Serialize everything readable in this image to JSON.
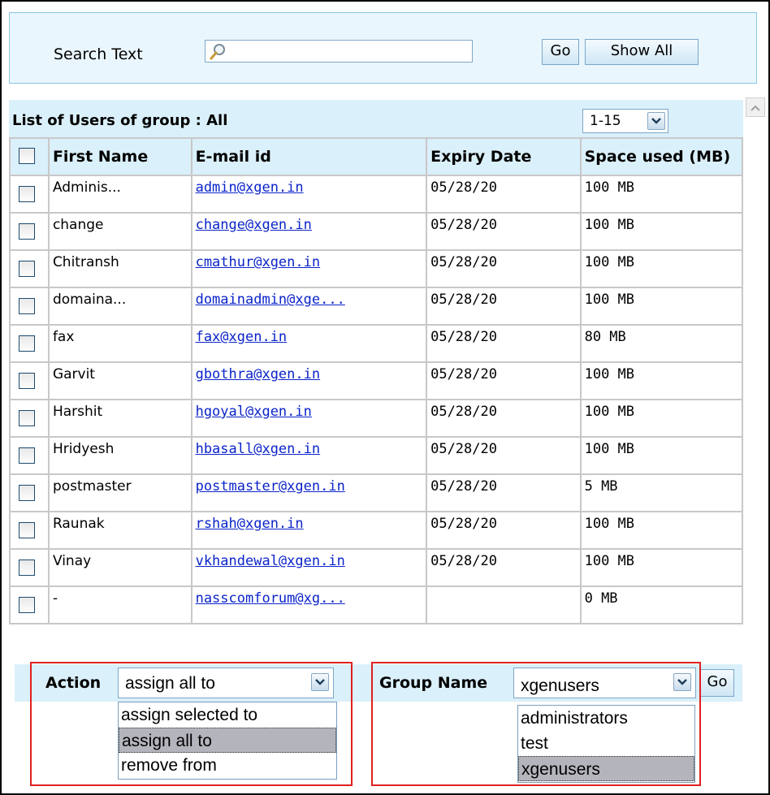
{
  "search": {
    "label": "Search Text",
    "value": "",
    "go_label": "Go",
    "show_all_label": "Show All"
  },
  "list": {
    "title": "List of Users of group : All",
    "range": "1-15",
    "headers": {
      "first_name": "First Name",
      "email": "E-mail id",
      "expiry": "Expiry Date",
      "space": "Space used (MB)"
    },
    "rows": [
      {
        "first_name": "Adminis...",
        "email": "admin@xgen.in",
        "expiry": "05/28/20",
        "space": "100 MB"
      },
      {
        "first_name": "change",
        "email": "change@xgen.in",
        "expiry": "05/28/20",
        "space": "100 MB"
      },
      {
        "first_name": "Chitransh",
        "email": "cmathur@xgen.in",
        "expiry": "05/28/20",
        "space": "100 MB"
      },
      {
        "first_name": "domaina...",
        "email": "domainadmin@xge...",
        "expiry": "05/28/20",
        "space": "100 MB"
      },
      {
        "first_name": "fax",
        "email": "fax@xgen.in",
        "expiry": "05/28/20",
        "space": "80 MB"
      },
      {
        "first_name": "Garvit",
        "email": "gbothra@xgen.in",
        "expiry": "05/28/20",
        "space": "100 MB"
      },
      {
        "first_name": "Harshit",
        "email": "hgoyal@xgen.in",
        "expiry": "05/28/20",
        "space": "100 MB"
      },
      {
        "first_name": "Hridyesh",
        "email": "hbasall@xgen.in",
        "expiry": "05/28/20",
        "space": "100 MB"
      },
      {
        "first_name": "postmaster",
        "email": "postmaster@xgen.in",
        "expiry": "05/28/20",
        "space": "5 MB"
      },
      {
        "first_name": "Raunak",
        "email": "rshah@xgen.in",
        "expiry": "05/28/20",
        "space": "100 MB"
      },
      {
        "first_name": "Vinay",
        "email": "vkhandewal@xgen.in",
        "expiry": "05/28/20",
        "space": "100 MB"
      },
      {
        "first_name": "-",
        "email": "nasscomforum@xg...",
        "expiry": "",
        "space": "0 MB"
      }
    ]
  },
  "action": {
    "label": "Action",
    "selected": "assign all to",
    "options": [
      "assign selected to",
      "assign all to",
      "remove from"
    ]
  },
  "group": {
    "label": "Group Name",
    "selected": "xgenusers",
    "options": [
      "administrators",
      "test",
      "xgenusers"
    ],
    "go_label": "Go"
  },
  "colors": {
    "panel_bg": "#eaf6fd",
    "header_bg": "#daf0fa",
    "link": "#0b24c9",
    "highlight_border": "#e02020"
  }
}
